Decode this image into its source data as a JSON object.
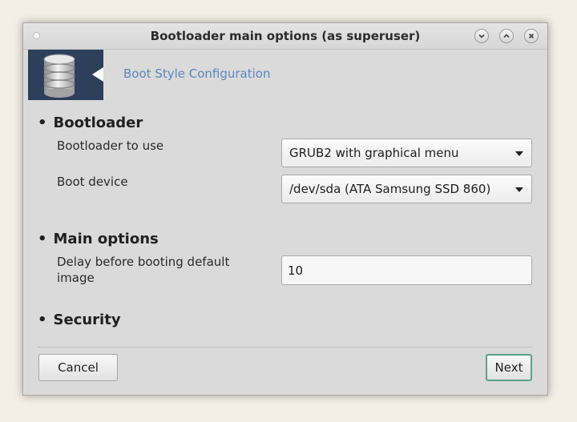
{
  "window": {
    "title": "Bootloader main options (as superuser)"
  },
  "banner": {
    "icon": "database-stack-icon",
    "title": "Boot Style Configuration"
  },
  "sections": {
    "bootloader": {
      "heading": "Bootloader",
      "bootloader_label": "Bootloader to use",
      "bootloader_value": "GRUB2 with graphical menu",
      "device_label": "Boot device",
      "device_value": "/dev/sda (ATA Samsung SSD 860)"
    },
    "main_options": {
      "heading": "Main options",
      "delay_label_line1": "Delay before booting default",
      "delay_label_line2": "image",
      "delay_value": "10"
    },
    "security": {
      "heading": "Security"
    }
  },
  "buttons": {
    "cancel": "Cancel",
    "next": "Next"
  },
  "colors": {
    "accent_link": "#5b86bf",
    "next_border": "#5aa28c",
    "banner_bg": "#2d3f5a"
  }
}
